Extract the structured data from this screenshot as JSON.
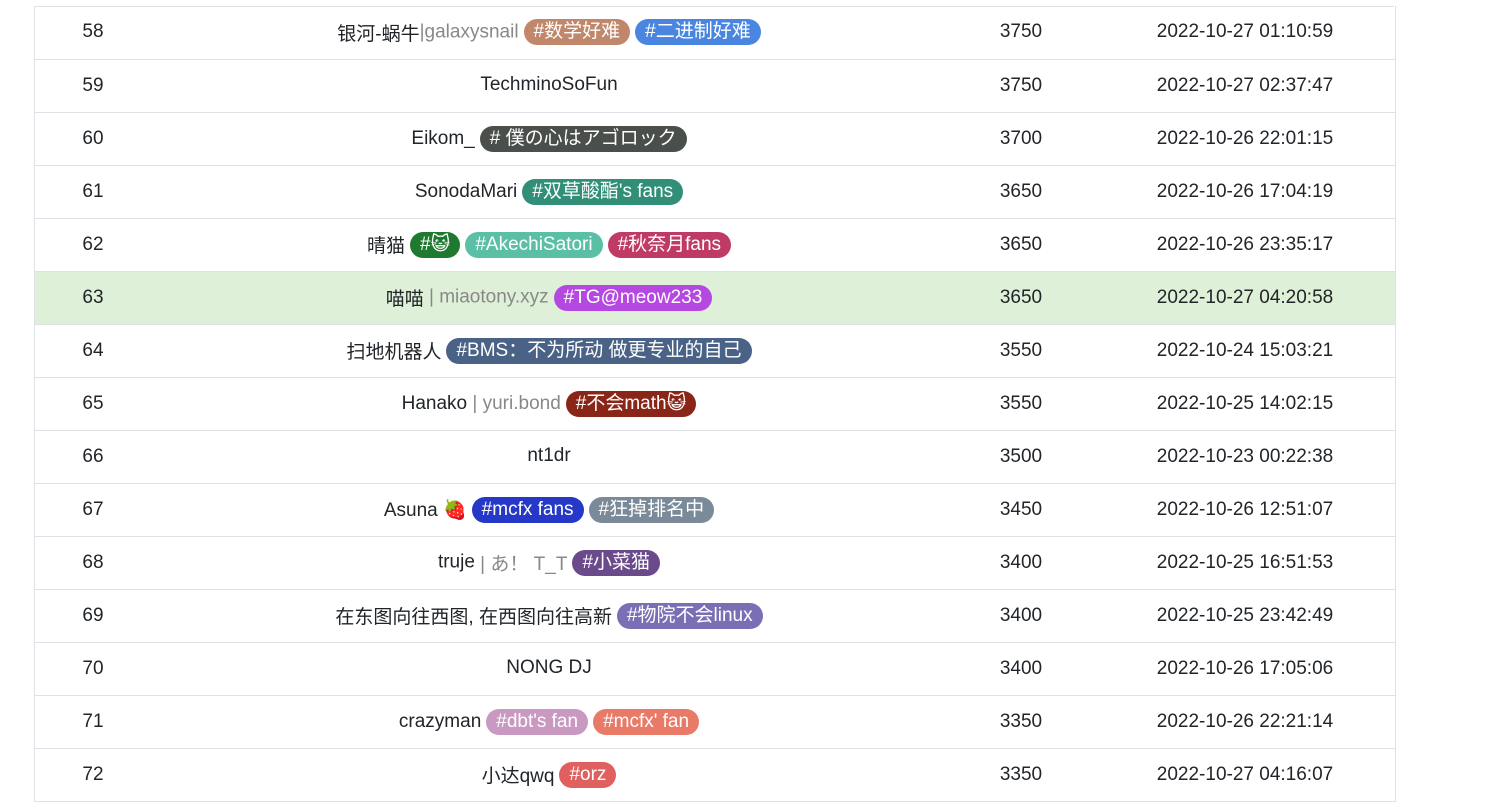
{
  "rows": [
    {
      "rank": "58",
      "name": "银河-蜗牛",
      "suffix": "|galaxysnail",
      "tags": [
        {
          "text": "#数学好难",
          "color": "#c0876b"
        },
        {
          "text": "#二进制好难",
          "color": "#4a86e0"
        }
      ],
      "score": "3750",
      "time": "2022-10-27 01:10:59",
      "highlight": false
    },
    {
      "rank": "59",
      "name": "TechminoSoFun",
      "suffix": "",
      "tags": [],
      "score": "3750",
      "time": "2022-10-27 02:37:47",
      "highlight": false
    },
    {
      "rank": "60",
      "name": "Eikom_",
      "suffix": "",
      "tags": [
        {
          "text": "# 僕の心はアゴロック",
          "color": "#4a4f4c"
        }
      ],
      "score": "3700",
      "time": "2022-10-26 22:01:15",
      "highlight": false
    },
    {
      "rank": "61",
      "name": "SonodaMari",
      "suffix": "",
      "tags": [
        {
          "text": "#双草酸酯's fans",
          "color": "#318e77"
        }
      ],
      "score": "3650",
      "time": "2022-10-26 17:04:19",
      "highlight": false
    },
    {
      "rank": "62",
      "name": "晴猫",
      "suffix": "",
      "tags": [
        {
          "text": "#😺",
          "color": "#1d7a2e"
        },
        {
          "text": "#AkechiSatori",
          "color": "#5bbfa6"
        },
        {
          "text": "#秋奈月fans",
          "color": "#c03a66"
        }
      ],
      "score": "3650",
      "time": "2022-10-26 23:35:17",
      "highlight": false
    },
    {
      "rank": "63",
      "name": "喵喵",
      "suffix": " | miaotony.xyz",
      "tags": [
        {
          "text": "#TG@meow233",
          "color": "#b548e0"
        }
      ],
      "score": "3650",
      "time": "2022-10-27 04:20:58",
      "highlight": true
    },
    {
      "rank": "64",
      "name": "扫地机器人",
      "suffix": "",
      "tags": [
        {
          "text": "#BMS：不为所动 做更专业的自己",
          "color": "#4a6285"
        }
      ],
      "score": "3550",
      "time": "2022-10-24 15:03:21",
      "highlight": false
    },
    {
      "rank": "65",
      "name": "Hanako",
      "suffix": " | yuri.bond",
      "tags": [
        {
          "text": "#不会math😺",
          "color": "#8a2618"
        }
      ],
      "score": "3550",
      "time": "2022-10-25 14:02:15",
      "highlight": false
    },
    {
      "rank": "66",
      "name": "nt1dr",
      "suffix": "",
      "tags": [],
      "score": "3500",
      "time": "2022-10-23 00:22:38",
      "highlight": false
    },
    {
      "rank": "67",
      "name": "Asuna 🍓",
      "suffix": "",
      "tags": [
        {
          "text": "#mcfx fans",
          "color": "#2538c8"
        },
        {
          "text": "#狂掉排名中",
          "color": "#7a8a99"
        }
      ],
      "score": "3450",
      "time": "2022-10-26 12:51:07",
      "highlight": false
    },
    {
      "rank": "68",
      "name": "truje",
      "suffix": " | あ！ T_T",
      "tags": [
        {
          "text": "#小菜猫",
          "color": "#6a4a8a"
        }
      ],
      "score": "3400",
      "time": "2022-10-25 16:51:53",
      "highlight": false
    },
    {
      "rank": "69",
      "name": "在东图向往西图, 在西图向往高新",
      "suffix": "",
      "tags": [
        {
          "text": "#物院不会linux",
          "color": "#7a6fb5"
        }
      ],
      "score": "3400",
      "time": "2022-10-25 23:42:49",
      "highlight": false
    },
    {
      "rank": "70",
      "name": "NONG DJ",
      "suffix": "",
      "tags": [],
      "score": "3400",
      "time": "2022-10-26 17:05:06",
      "highlight": false
    },
    {
      "rank": "71",
      "name": "crazyman",
      "suffix": "",
      "tags": [
        {
          "text": "#dbt's fan",
          "color": "#c999c2"
        },
        {
          "text": "#mcfx' fan",
          "color": "#ea7a68"
        }
      ],
      "score": "3350",
      "time": "2022-10-26 22:21:14",
      "highlight": false
    },
    {
      "rank": "72",
      "name": "小达qwq",
      "suffix": "",
      "tags": [
        {
          "text": "#orz",
          "color": "#e06060"
        }
      ],
      "score": "3350",
      "time": "2022-10-27 04:16:07",
      "highlight": false
    }
  ]
}
